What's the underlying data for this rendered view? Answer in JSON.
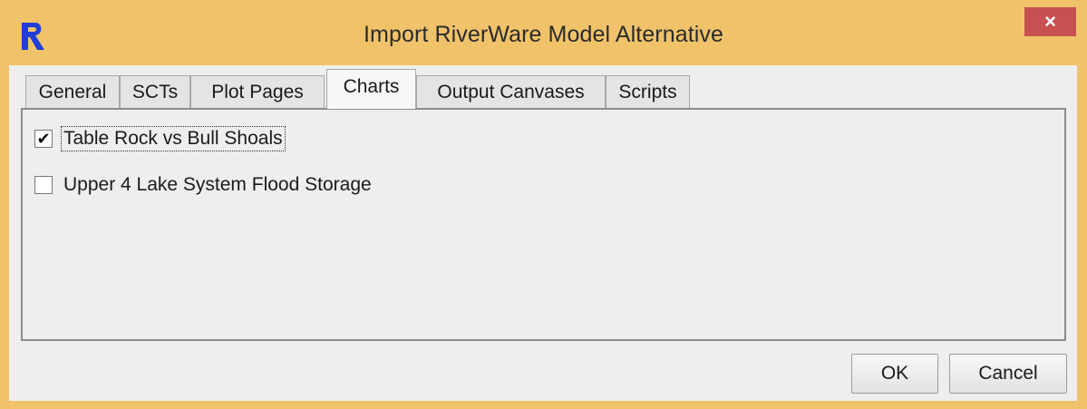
{
  "window": {
    "title": "Import RiverWare Model Alternative",
    "app_icon": "riverware-logo-icon",
    "close_icon": "close-icon",
    "close_glyph": "×",
    "colors": {
      "frame": "#f0c36b",
      "close": "#c75050",
      "logo": "#1f3fd6"
    }
  },
  "tabs": [
    {
      "label": "General",
      "active": false
    },
    {
      "label": "SCTs",
      "active": false
    },
    {
      "label": "Plot Pages",
      "active": false
    },
    {
      "label": "Charts",
      "active": true
    },
    {
      "label": "Output Canvases",
      "active": false
    },
    {
      "label": "Scripts",
      "active": false
    }
  ],
  "charts": [
    {
      "label": "Table Rock vs Bull Shoals",
      "checked": true,
      "check_glyph": "✔"
    },
    {
      "label": "Upper 4 Lake System Flood Storage",
      "checked": false,
      "check_glyph": ""
    }
  ],
  "buttons": {
    "ok": "OK",
    "cancel": "Cancel"
  }
}
